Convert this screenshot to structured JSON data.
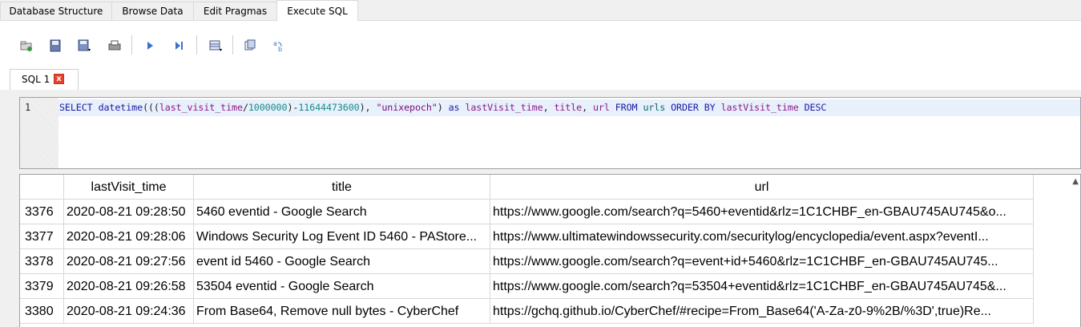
{
  "tabs": [
    "Database Structure",
    "Browse Data",
    "Edit Pragmas",
    "Execute SQL"
  ],
  "active_tab": "Execute SQL",
  "toolbar_icons": [
    "open-tab-icon",
    "open-sql-icon",
    "save-sql-icon",
    "print-icon",
    "execute-all-icon",
    "execute-line-icon",
    "save-results-icon",
    "find-icon",
    "find-replace-icon"
  ],
  "sql_tab": {
    "label": "SQL 1",
    "close": "x"
  },
  "editor": {
    "line_number": "1",
    "tokens": {
      "t1": "SELECT",
      "t2": " ",
      "t3": "datetime",
      "t4": "(((",
      "t5": "last_visit_time",
      "t6": "/",
      "t7": "1000000",
      "t8": ")-",
      "t9": "11644473600",
      "t10": "), ",
      "t11": "\"unixepoch\"",
      "t12": ") ",
      "t13": "as",
      "t14": " ",
      "t15": "lastVisit_time",
      "t16": ", ",
      "t17": "title",
      "t18": ", ",
      "t19": "url",
      "t20": " ",
      "t21": "FROM",
      "t22": " ",
      "t23": "urls",
      "t24": " ",
      "t25": "ORDER BY",
      "t26": " ",
      "t27": "lastVisit_time",
      "t28": " ",
      "t29": "DESC"
    }
  },
  "results": {
    "columns": [
      "lastVisit_time",
      "title",
      "url"
    ],
    "rows": [
      {
        "n": "3376",
        "time": "2020-08-21 09:28:50",
        "title": "5460 eventid - Google Search",
        "url": "https://www.google.com/search?q=5460+eventid&rlz=1C1CHBF_en-GBAU745AU745&o..."
      },
      {
        "n": "3377",
        "time": "2020-08-21 09:28:06",
        "title": "Windows Security Log Event ID 5460 - PAStore...",
        "url": "https://www.ultimatewindowssecurity.com/securitylog/encyclopedia/event.aspx?eventI..."
      },
      {
        "n": "3378",
        "time": "2020-08-21 09:27:56",
        "title": "event id 5460 - Google Search",
        "url": "https://www.google.com/search?q=event+id+5460&rlz=1C1CHBF_en-GBAU745AU745..."
      },
      {
        "n": "3379",
        "time": "2020-08-21 09:26:58",
        "title": "53504 eventid - Google Search",
        "url": "https://www.google.com/search?q=53504+eventid&rlz=1C1CHBF_en-GBAU745AU745&..."
      },
      {
        "n": "3380",
        "time": "2020-08-21 09:24:36",
        "title": "From Base64, Remove null bytes - CyberChef",
        "url": "https://gchq.github.io/CyberChef/#recipe=From_Base64('A-Za-z0-9%2B/%3D',true)Re..."
      }
    ]
  }
}
